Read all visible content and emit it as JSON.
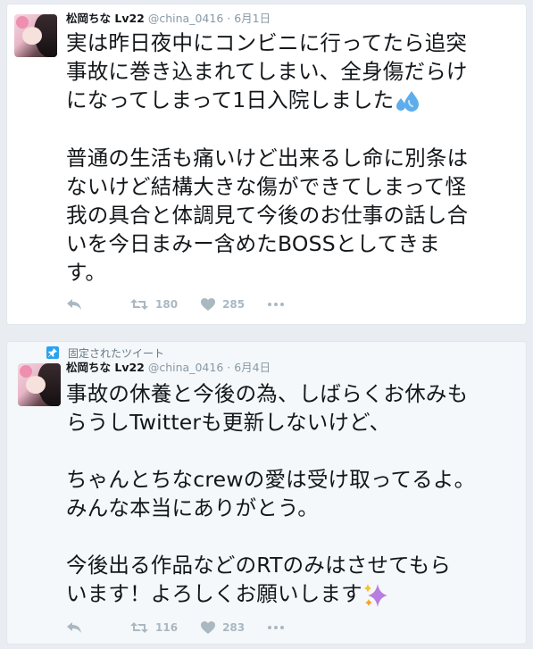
{
  "tweets": [
    {
      "name": "松岡ちな Lv22",
      "handle": "@china_0416",
      "separator": "·",
      "date": "6月1日",
      "text_lines": [
        "実は昨日夜中にコンビニに行ってたら追突",
        "事故に巻き込まれてしまい、全身傷だらけ",
        "になってしまって1日入院しました",
        "",
        "普通の生活も痛いけど出来るし命に別条は",
        "ないけど結構大きな傷ができてしまって怪",
        "我の具合と体調見て今後のお仕事の話し合",
        "いを今日まみー含めたBOSSとしてきま",
        "す。"
      ],
      "emoji": "sweat-droplets",
      "retweets": "180",
      "likes": "285"
    },
    {
      "pinned_label": "固定されたツイート",
      "name": "松岡ちな Lv22",
      "handle": "@china_0416",
      "separator": "·",
      "date": "6月4日",
      "text_lines": [
        "事故の休養と今後の為、しばらくお休みも",
        "らうしTwitterも更新しないけど、",
        "",
        "ちゃんとちなcrewの愛は受け取ってるよ。",
        "みんな本当にありがとう。",
        "",
        "今後出る作品などのRTのみはさせてもら",
        "います！よろしくお願いします"
      ],
      "emoji": "sparkles",
      "retweets": "116",
      "likes": "283"
    }
  ],
  "icons": {
    "reply": "reply-icon",
    "retweet": "retweet-icon",
    "like": "heart-icon",
    "more": "more-icon",
    "pin": "pin-icon"
  },
  "colors": {
    "icon_gray": "#aab8c2",
    "pin_blue": "#2aa3ef",
    "meta_gray": "#8899a6"
  }
}
